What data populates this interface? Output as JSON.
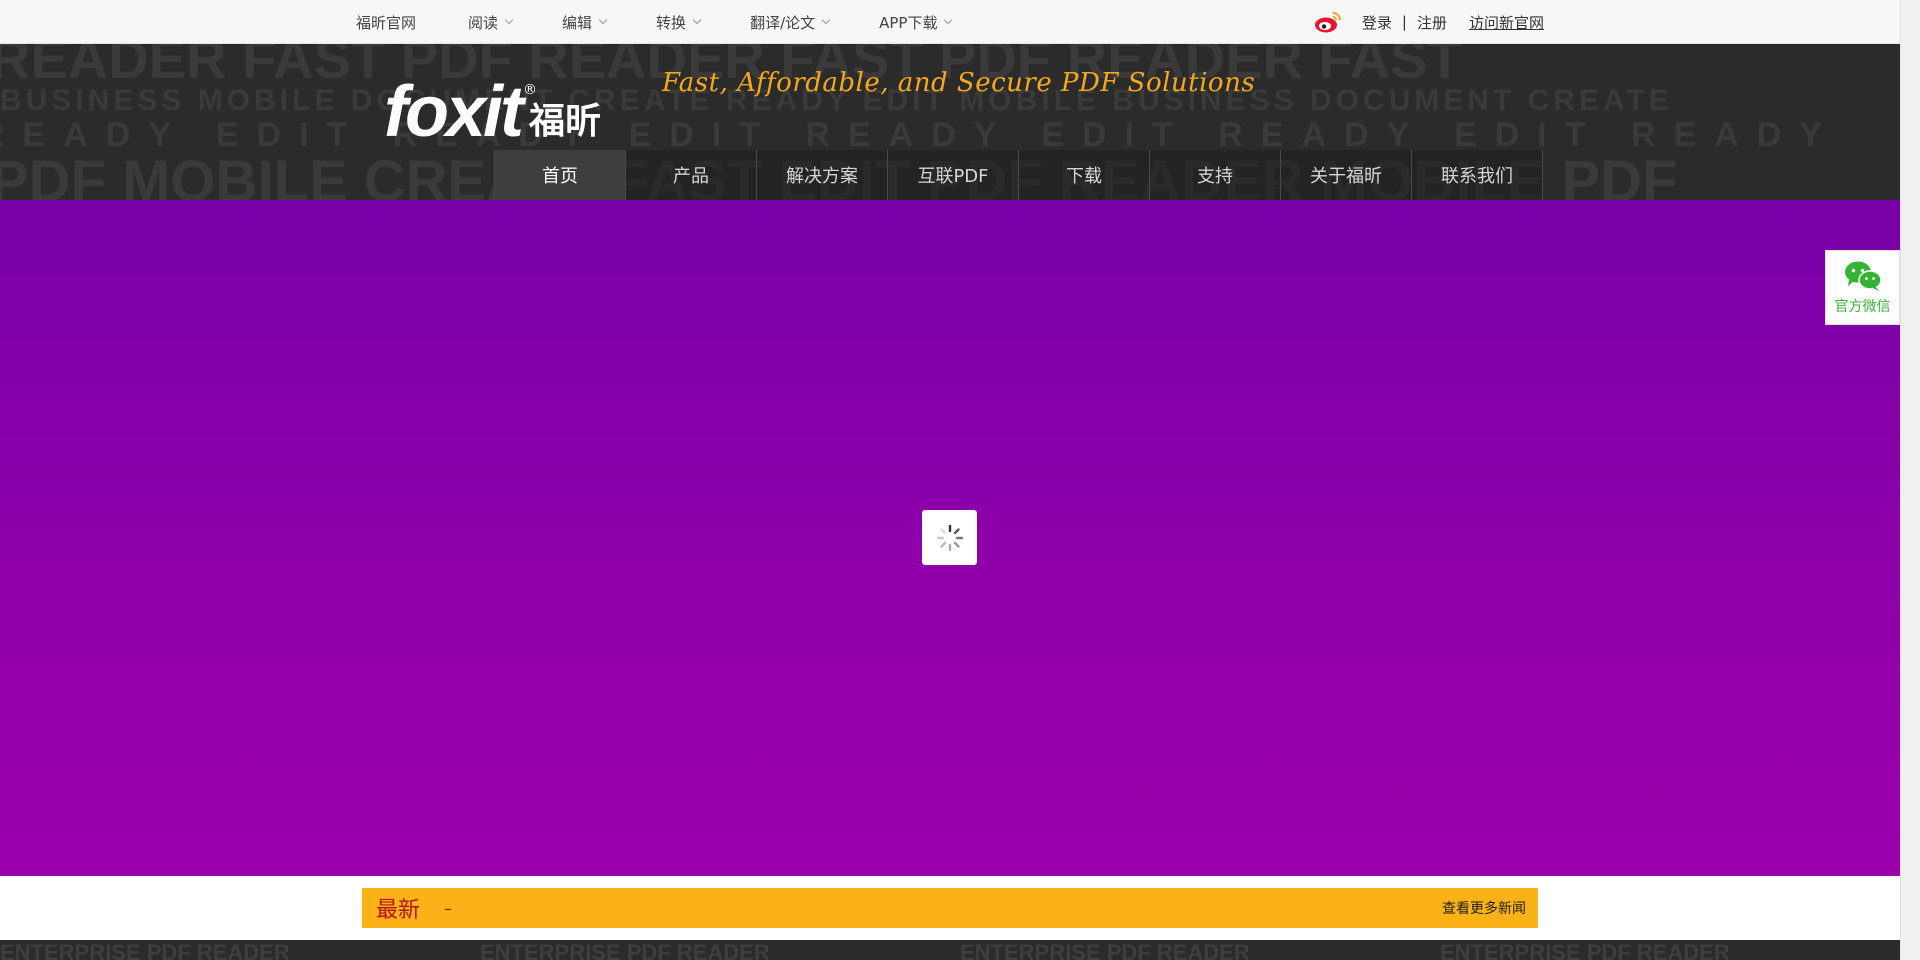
{
  "topbar": {
    "items": [
      {
        "label": "福昕官网",
        "has_dropdown": false
      },
      {
        "label": "阅读",
        "has_dropdown": true
      },
      {
        "label": "编辑",
        "has_dropdown": true
      },
      {
        "label": "转换",
        "has_dropdown": true
      },
      {
        "label": "翻译/论文",
        "has_dropdown": true
      },
      {
        "label": "APP下载",
        "has_dropdown": true
      }
    ],
    "login": "登录",
    "separator": "|",
    "register": "注册",
    "visit_new": "访问新官网",
    "weibo_icon": "weibo-icon"
  },
  "header": {
    "logo_text": "foxit",
    "logo_reg": "®",
    "logo_cn": "福昕",
    "slogan": "Fast, Affordable, and Secure PDF Solutions"
  },
  "nav": {
    "items": [
      "首页",
      "产品",
      "解决方案",
      "互联PDF",
      "下载",
      "支持",
      "关于福昕",
      "联系我们"
    ],
    "active_index": 0
  },
  "hero": {
    "colors": {
      "top": "#7800a8",
      "bottom": "#9b00ab"
    },
    "loading_icon": "spinner-icon"
  },
  "wechat": {
    "label": "官方微信",
    "icon": "wechat-icon"
  },
  "news": {
    "title": "最新",
    "dash": "–",
    "more": "查看更多新闻",
    "bar_color": "#fbb216"
  }
}
